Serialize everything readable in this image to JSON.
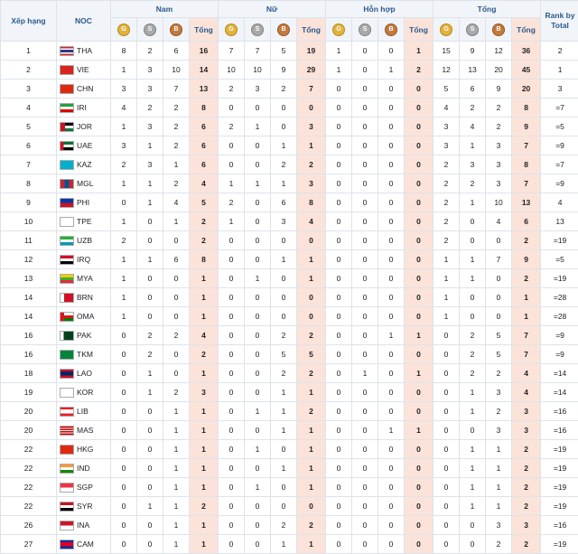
{
  "headers": {
    "rank": "Xếp hạng",
    "noc": "NOC",
    "groups": [
      "Nam",
      "Nữ",
      "Hỗn hợp",
      "Tổng"
    ],
    "total": "Tổng",
    "rank_by_total": "Rank by Total",
    "medal_letters": {
      "gold": "G",
      "silver": "S",
      "bronze": "B"
    }
  },
  "colors": {
    "tong_bg": "#fbe3da",
    "header_bg": "#f1f4f8",
    "header_text": "#2a5a8c",
    "gold": "#e3b23c",
    "silver": "#a9a9a9",
    "bronze": "#c47a3b"
  },
  "rows": [
    {
      "rank": "1",
      "code": "THA",
      "flag": "tha",
      "m": [
        "8",
        "2",
        "6",
        "16"
      ],
      "w": [
        "7",
        "7",
        "5",
        "19"
      ],
      "x": [
        "1",
        "0",
        "0",
        "1"
      ],
      "t": [
        "15",
        "9",
        "12",
        "36"
      ],
      "rt": "2"
    },
    {
      "rank": "2",
      "code": "VIE",
      "flag": "vie",
      "m": [
        "1",
        "3",
        "10",
        "14"
      ],
      "w": [
        "10",
        "10",
        "9",
        "29"
      ],
      "x": [
        "1",
        "0",
        "1",
        "2"
      ],
      "t": [
        "12",
        "13",
        "20",
        "45"
      ],
      "rt": "1"
    },
    {
      "rank": "3",
      "code": "CHN",
      "flag": "chn",
      "m": [
        "3",
        "3",
        "7",
        "13"
      ],
      "w": [
        "2",
        "3",
        "2",
        "7"
      ],
      "x": [
        "0",
        "0",
        "0",
        "0"
      ],
      "t": [
        "5",
        "6",
        "9",
        "20"
      ],
      "rt": "3"
    },
    {
      "rank": "4",
      "code": "IRI",
      "flag": "iri",
      "m": [
        "4",
        "2",
        "2",
        "8"
      ],
      "w": [
        "0",
        "0",
        "0",
        "0"
      ],
      "x": [
        "0",
        "0",
        "0",
        "0"
      ],
      "t": [
        "4",
        "2",
        "2",
        "8"
      ],
      "rt": "=7"
    },
    {
      "rank": "5",
      "code": "JOR",
      "flag": "jor",
      "m": [
        "1",
        "3",
        "2",
        "6"
      ],
      "w": [
        "2",
        "1",
        "0",
        "3"
      ],
      "x": [
        "0",
        "0",
        "0",
        "0"
      ],
      "t": [
        "3",
        "4",
        "2",
        "9"
      ],
      "rt": "=5"
    },
    {
      "rank": "6",
      "code": "UAE",
      "flag": "uae",
      "m": [
        "3",
        "1",
        "2",
        "6"
      ],
      "w": [
        "0",
        "0",
        "1",
        "1"
      ],
      "x": [
        "0",
        "0",
        "0",
        "0"
      ],
      "t": [
        "3",
        "1",
        "3",
        "7"
      ],
      "rt": "=9"
    },
    {
      "rank": "7",
      "code": "KAZ",
      "flag": "kaz",
      "m": [
        "2",
        "3",
        "1",
        "6"
      ],
      "w": [
        "0",
        "0",
        "2",
        "2"
      ],
      "x": [
        "0",
        "0",
        "0",
        "0"
      ],
      "t": [
        "2",
        "3",
        "3",
        "8"
      ],
      "rt": "=7"
    },
    {
      "rank": "8",
      "code": "MGL",
      "flag": "mgl",
      "m": [
        "1",
        "1",
        "2",
        "4"
      ],
      "w": [
        "1",
        "1",
        "1",
        "3"
      ],
      "x": [
        "0",
        "0",
        "0",
        "0"
      ],
      "t": [
        "2",
        "2",
        "3",
        "7"
      ],
      "rt": "=9"
    },
    {
      "rank": "9",
      "code": "PHI",
      "flag": "phi",
      "m": [
        "0",
        "1",
        "4",
        "5"
      ],
      "w": [
        "2",
        "0",
        "6",
        "8"
      ],
      "x": [
        "0",
        "0",
        "0",
        "0"
      ],
      "t": [
        "2",
        "1",
        "10",
        "13"
      ],
      "rt": "4"
    },
    {
      "rank": "10",
      "code": "TPE",
      "flag": "tpe",
      "m": [
        "1",
        "0",
        "1",
        "2"
      ],
      "w": [
        "1",
        "0",
        "3",
        "4"
      ],
      "x": [
        "0",
        "0",
        "0",
        "0"
      ],
      "t": [
        "2",
        "0",
        "4",
        "6"
      ],
      "rt": "13"
    },
    {
      "rank": "11",
      "code": "UZB",
      "flag": "uzb",
      "m": [
        "2",
        "0",
        "0",
        "2"
      ],
      "w": [
        "0",
        "0",
        "0",
        "0"
      ],
      "x": [
        "0",
        "0",
        "0",
        "0"
      ],
      "t": [
        "2",
        "0",
        "0",
        "2"
      ],
      "rt": "=19"
    },
    {
      "rank": "12",
      "code": "IRQ",
      "flag": "irq",
      "m": [
        "1",
        "1",
        "6",
        "8"
      ],
      "w": [
        "0",
        "0",
        "1",
        "1"
      ],
      "x": [
        "0",
        "0",
        "0",
        "0"
      ],
      "t": [
        "1",
        "1",
        "7",
        "9"
      ],
      "rt": "=5"
    },
    {
      "rank": "13",
      "code": "MYA",
      "flag": "mya",
      "m": [
        "1",
        "0",
        "0",
        "1"
      ],
      "w": [
        "0",
        "1",
        "0",
        "1"
      ],
      "x": [
        "0",
        "0",
        "0",
        "0"
      ],
      "t": [
        "1",
        "1",
        "0",
        "2"
      ],
      "rt": "=19"
    },
    {
      "rank": "14",
      "code": "BRN",
      "flag": "brn",
      "m": [
        "1",
        "0",
        "0",
        "1"
      ],
      "w": [
        "0",
        "0",
        "0",
        "0"
      ],
      "x": [
        "0",
        "0",
        "0",
        "0"
      ],
      "t": [
        "1",
        "0",
        "0",
        "1"
      ],
      "rt": "=28"
    },
    {
      "rank": "14",
      "code": "OMA",
      "flag": "oma",
      "m": [
        "1",
        "0",
        "0",
        "1"
      ],
      "w": [
        "0",
        "0",
        "0",
        "0"
      ],
      "x": [
        "0",
        "0",
        "0",
        "0"
      ],
      "t": [
        "1",
        "0",
        "0",
        "1"
      ],
      "rt": "=28"
    },
    {
      "rank": "16",
      "code": "PAK",
      "flag": "pak",
      "m": [
        "0",
        "2",
        "2",
        "4"
      ],
      "w": [
        "0",
        "0",
        "2",
        "2"
      ],
      "x": [
        "0",
        "0",
        "1",
        "1"
      ],
      "t": [
        "0",
        "2",
        "5",
        "7"
      ],
      "rt": "=9"
    },
    {
      "rank": "16",
      "code": "TKM",
      "flag": "tkm",
      "m": [
        "0",
        "2",
        "0",
        "2"
      ],
      "w": [
        "0",
        "0",
        "5",
        "5"
      ],
      "x": [
        "0",
        "0",
        "0",
        "0"
      ],
      "t": [
        "0",
        "2",
        "5",
        "7"
      ],
      "rt": "=9"
    },
    {
      "rank": "18",
      "code": "LAO",
      "flag": "lao",
      "m": [
        "0",
        "1",
        "0",
        "1"
      ],
      "w": [
        "0",
        "0",
        "2",
        "2"
      ],
      "x": [
        "0",
        "1",
        "0",
        "1"
      ],
      "t": [
        "0",
        "2",
        "2",
        "4"
      ],
      "rt": "=14"
    },
    {
      "rank": "19",
      "code": "KOR",
      "flag": "kor",
      "m": [
        "0",
        "1",
        "2",
        "3"
      ],
      "w": [
        "0",
        "0",
        "1",
        "1"
      ],
      "x": [
        "0",
        "0",
        "0",
        "0"
      ],
      "t": [
        "0",
        "1",
        "3",
        "4"
      ],
      "rt": "=14"
    },
    {
      "rank": "20",
      "code": "LIB",
      "flag": "lib",
      "m": [
        "0",
        "0",
        "1",
        "1"
      ],
      "w": [
        "0",
        "1",
        "1",
        "2"
      ],
      "x": [
        "0",
        "0",
        "0",
        "0"
      ],
      "t": [
        "0",
        "1",
        "2",
        "3"
      ],
      "rt": "=16"
    },
    {
      "rank": "20",
      "code": "MAS",
      "flag": "mas",
      "m": [
        "0",
        "0",
        "1",
        "1"
      ],
      "w": [
        "0",
        "0",
        "1",
        "1"
      ],
      "x": [
        "0",
        "0",
        "1",
        "1"
      ],
      "t": [
        "0",
        "0",
        "3",
        "3"
      ],
      "rt": "=16"
    },
    {
      "rank": "22",
      "code": "HKG",
      "flag": "hkg",
      "m": [
        "0",
        "0",
        "1",
        "1"
      ],
      "w": [
        "0",
        "1",
        "0",
        "1"
      ],
      "x": [
        "0",
        "0",
        "0",
        "0"
      ],
      "t": [
        "0",
        "1",
        "1",
        "2"
      ],
      "rt": "=19"
    },
    {
      "rank": "22",
      "code": "IND",
      "flag": "ind",
      "m": [
        "0",
        "0",
        "1",
        "1"
      ],
      "w": [
        "0",
        "0",
        "1",
        "1"
      ],
      "x": [
        "0",
        "0",
        "0",
        "0"
      ],
      "t": [
        "0",
        "1",
        "1",
        "2"
      ],
      "rt": "=19"
    },
    {
      "rank": "22",
      "code": "SGP",
      "flag": "sgp",
      "m": [
        "0",
        "0",
        "1",
        "1"
      ],
      "w": [
        "0",
        "1",
        "0",
        "1"
      ],
      "x": [
        "0",
        "0",
        "0",
        "0"
      ],
      "t": [
        "0",
        "1",
        "1",
        "2"
      ],
      "rt": "=19"
    },
    {
      "rank": "22",
      "code": "SYR",
      "flag": "syr",
      "m": [
        "0",
        "1",
        "1",
        "2"
      ],
      "w": [
        "0",
        "0",
        "0",
        "0"
      ],
      "x": [
        "0",
        "0",
        "0",
        "0"
      ],
      "t": [
        "0",
        "1",
        "1",
        "2"
      ],
      "rt": "=19"
    },
    {
      "rank": "26",
      "code": "INA",
      "flag": "ina",
      "m": [
        "0",
        "0",
        "1",
        "1"
      ],
      "w": [
        "0",
        "0",
        "2",
        "2"
      ],
      "x": [
        "0",
        "0",
        "0",
        "0"
      ],
      "t": [
        "0",
        "0",
        "3",
        "3"
      ],
      "rt": "=16"
    },
    {
      "rank": "27",
      "code": "CAM",
      "flag": "cam",
      "m": [
        "0",
        "0",
        "1",
        "1"
      ],
      "w": [
        "0",
        "0",
        "1",
        "1"
      ],
      "x": [
        "0",
        "0",
        "0",
        "0"
      ],
      "t": [
        "0",
        "0",
        "2",
        "2"
      ],
      "rt": "=19"
    }
  ]
}
